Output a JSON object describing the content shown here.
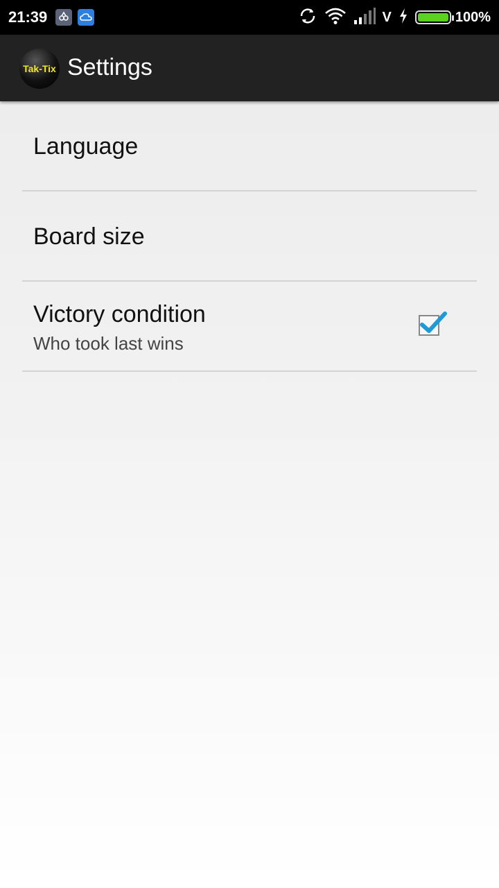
{
  "status_bar": {
    "time": "21:39",
    "carrier": "V",
    "battery": "100%",
    "battery_level": 1.0,
    "icons": [
      "notification-app-icon",
      "cloud-icon",
      "sync-icon",
      "wifi-icon",
      "signal-icon",
      "charging-icon",
      "battery-icon"
    ]
  },
  "app_bar": {
    "logo_text": "Tak-Tix",
    "title": "Settings"
  },
  "preferences": [
    {
      "title": "Language"
    },
    {
      "title": "Board size"
    },
    {
      "title": "Victory condition",
      "summary": "Who took last wins",
      "checked": true
    }
  ],
  "colors": {
    "checkbox_accent": "#1f9ad6",
    "logo_text": "#f4e81a",
    "battery_fill": "#5bd21f"
  }
}
